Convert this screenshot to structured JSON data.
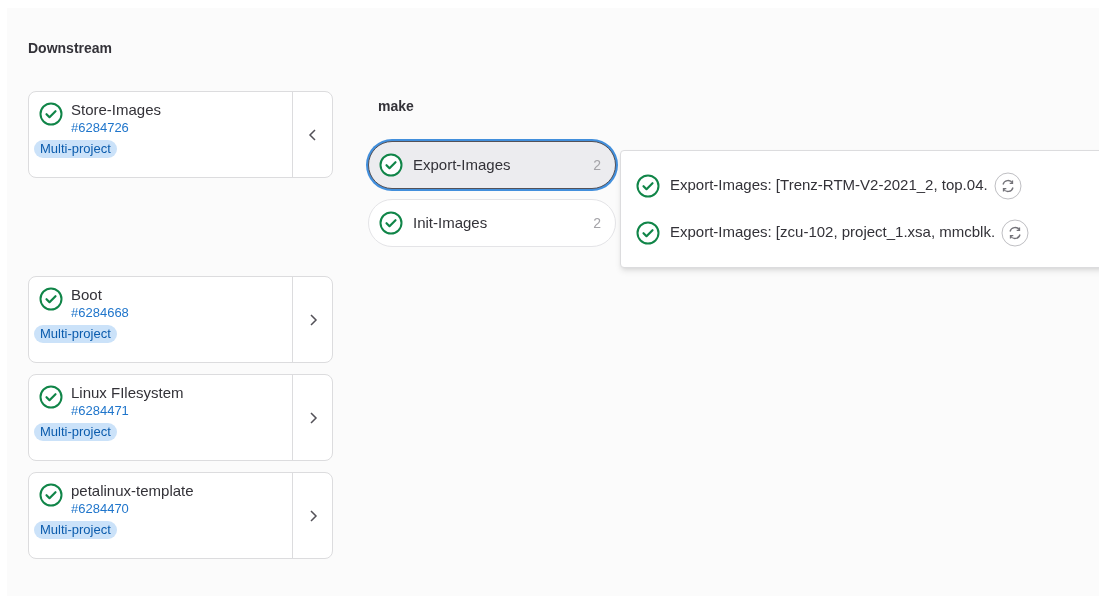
{
  "section_title": "Downstream",
  "pipelines": [
    {
      "name": "Store-Images",
      "id": "#6284726",
      "badge": "Multi-project",
      "kind": "success",
      "expanded": true
    },
    {
      "name": "Boot",
      "id": "#6284668",
      "badge": "Multi-project",
      "kind": "success",
      "expanded": false
    },
    {
      "name": "Linux FIlesystem",
      "id": "#6284471",
      "badge": "Multi-project",
      "kind": "success",
      "expanded": false
    },
    {
      "name": "petalinux-template",
      "id": "#6284470",
      "badge": "Multi-project",
      "kind": "success",
      "expanded": false
    }
  ],
  "stage": {
    "title": "make",
    "jobs": [
      {
        "name": "Export-Images",
        "count": "2",
        "kind": "success",
        "selected": true
      },
      {
        "name": "Init-Images",
        "count": "2",
        "kind": "success",
        "selected": false
      }
    ]
  },
  "dropdown": {
    "items": [
      {
        "name": "Export-Images: [Trenz-RTM-V2-2021_2, top.04.",
        "kind": "success"
      },
      {
        "name": "Export-Images: [zcu-102, project_1.xsa, mmcblk.",
        "kind": "success"
      }
    ]
  }
}
